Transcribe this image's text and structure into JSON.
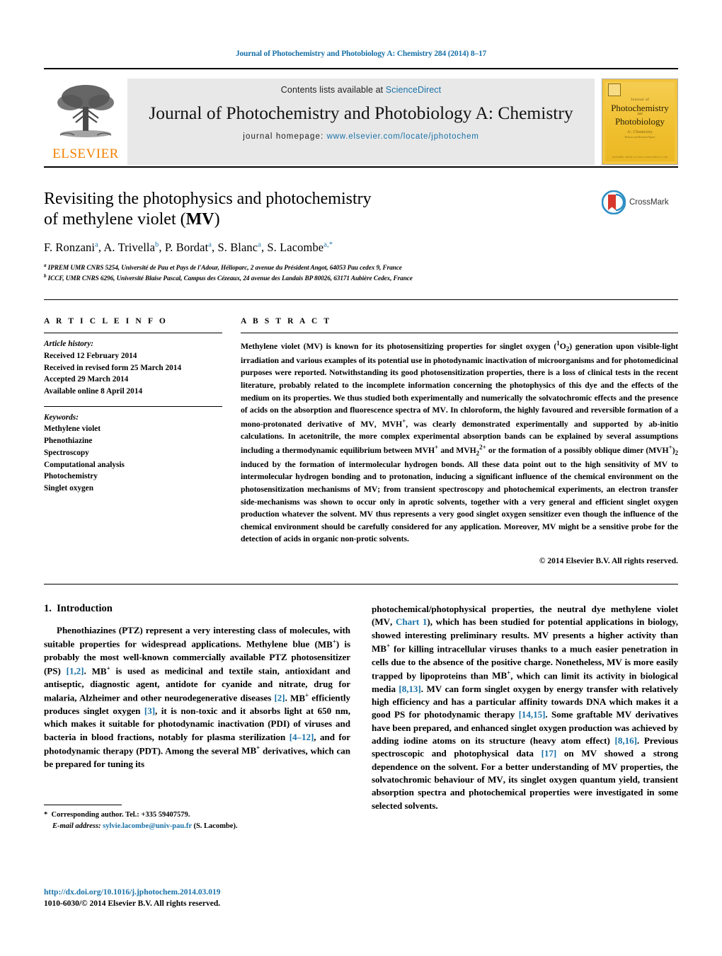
{
  "running_head": "Journal of Photochemistry and Photobiology A: Chemistry 284 (2014) 8–17",
  "masthead": {
    "publisher": "ELSEVIER",
    "contents_prefix": "Contents lists available at ",
    "contents_link": "ScienceDirect",
    "journal_title": "Journal of Photochemistry and Photobiology A: Chemistry",
    "homepage_label": "journal homepage:",
    "homepage_url": "www.elsevier.com/locate/jphotochem",
    "cover": {
      "journal_of": "Journal of",
      "line1": "Photochemistry",
      "and": "and",
      "line2": "Photobiology",
      "subtitle": "A: Chemistry",
      "subtitle2": "Reviews and Research Papers",
      "footer": "available online at www.sciencedirect.com"
    }
  },
  "article": {
    "title_line1": "Revisiting the photophysics and photochemistry",
    "title_line2_pre": "of methylene violet (",
    "title_line2_bold": "MV",
    "title_line2_post": ")",
    "crossmark_label": "CrossMark",
    "authors": [
      {
        "name": "F. Ronzani",
        "sup": "a",
        "sep": ", "
      },
      {
        "name": "A. Trivella",
        "sup": "b",
        "sep": ", "
      },
      {
        "name": "P. Bordat",
        "sup": "a",
        "sep": ", "
      },
      {
        "name": "S. Blanc",
        "sup": "a",
        "sep": ", "
      },
      {
        "name": "S. Lacombe",
        "sup": "a,*",
        "sep": ""
      }
    ],
    "affiliations": [
      {
        "marker": "a",
        "text": "IPREM UMR CNRS 5254, Université de Pau et Pays de l'Adour, Hélioparc, 2 avenue du Président Angot, 64053 Pau cedex 9, France"
      },
      {
        "marker": "b",
        "text": "ICCF, UMR CNRS 6296, Université Blaise Pascal, Campus des Cézeaux, 24 avenue des Landais BP 80026, 63171 Aubière Cedex, France"
      }
    ]
  },
  "article_info": {
    "heading": "A R T I C L E   I N F O",
    "history_label": "Article history:",
    "history": [
      "Received 12 February 2014",
      "Received in revised form 25 March 2014",
      "Accepted 29 March 2014",
      "Available online 8 April 2014"
    ],
    "keywords_label": "Keywords:",
    "keywords": [
      "Methylene violet",
      "Phenothiazine",
      "Spectroscopy",
      "Computational analysis",
      "Photochemistry",
      "Singlet oxygen"
    ]
  },
  "abstract": {
    "heading": "A B S T R A C T",
    "copyright": "© 2014 Elsevier B.V. All rights reserved.",
    "paragraphs": [
      "Methylene violet (MV) is known for its photosensitizing properties for singlet oxygen (1O2) generation upon visible-light irradiation and various examples of its potential use in photodynamic inactivation of microorganisms and for photomedicinal purposes were reported. Notwithstanding its good photosensitization properties, there is a loss of clinical tests in the recent literature, probably related to the incomplete information concerning the photophysics of this dye and the effects of the medium on its properties. We thus studied both experimentally and numerically the solvatochromic effects and the presence of acids on the absorption and fluorescence spectra of MV. In chloroform, the highly favoured and reversible formation of a mono-protonated derivative of MV, MVH+, was clearly demonstrated experimentally and supported by ab-initio calculations. In acetonitrile, the more complex experimental absorption bands can be explained by several assumptions including a thermodynamic equilibrium between MVH+ and MVH2 2+ or the formation of a possibly oblique dimer (MVH+)2 induced by the formation of intermolecular hydrogen bonds. All these data point out to the high sensitivity of MV to intermolecular hydrogen bonding and to protonation, inducing a significant influence of the chemical environment on the photosensitization mechanisms of MV; from transient spectroscopy and photochemical experiments, an electron transfer side-mechanisms was shown to occur only in aprotic solvents, together with a very general and efficient singlet oxygen production whatever the solvent. MV thus represents a very good singlet oxygen sensitizer even though the influence of the chemical environment should be carefully considered for any application. Moreover, MV might be a sensitive probe for the detection of acids in organic non-protic solvents."
    ]
  },
  "introduction": {
    "section_number": "1.",
    "section_title": "Introduction",
    "left_paragraph": "Phenothiazines (PTZ) represent a very interesting class of molecules, with suitable properties for widespread applications. Methylene blue (MB+) is probably the most well-known commercially available PTZ photosensitizer (PS) [1,2]. MB+ is used as medicinal and textile stain, antioxidant and antiseptic, diagnostic agent, antidote for cyanide and nitrate, drug for malaria, Alzheimer and other neurodegenerative diseases [2]. MB+ efficiently produces singlet oxygen [3], it is non-toxic and it absorbs light at 650 nm, which makes it suitable for photodynamic inactivation (PDI) of viruses and bacteria in blood fractions, notably for plasma sterilization [4–12], and for photodynamic therapy (PDT). Among the several MB+ derivatives, which can be prepared for tuning its",
    "right_paragraph": "photochemical/photophysical properties, the neutral dye methylene violet (MV, Chart 1), which has been studied for potential applications in biology, showed interesting preliminary results. MV presents a higher activity than MB+ for killing intracellular viruses thanks to a much easier penetration in cells due to the absence of the positive charge. Nonetheless, MV is more easily trapped by lipoproteins than MB+, which can limit its activity in biological media [8,13]. MV can form singlet oxygen by energy transfer with relatively high efficiency and has a particular affinity towards DNA which makes it a good PS for photodynamic therapy [14,15]. Some graftable MV derivatives have been prepared, and enhanced singlet oxygen production was achieved by adding iodine atoms on its structure (heavy atom effect) [8,16]. Previous spectroscopic and photophysical data [17] on MV showed a strong dependence on the solvent. For a better understanding of MV properties, the solvatochromic behaviour of MV, its singlet oxygen quantum yield, transient absorption spectra and photochemical properties were investigated in some selected solvents."
  },
  "footnote": {
    "star": "*",
    "corresponding": "Corresponding author. Tel.: +335 59407579.",
    "email_label": "E-mail address:",
    "email": "sylvie.lacombe@univ-pau.fr",
    "email_suffix": "(S. Lacombe)."
  },
  "doi_block": {
    "doi_url": "http://dx.doi.org/10.1016/j.jphotochem.2014.03.019",
    "issn_line": "1010-6030/© 2014 Elsevier B.V. All rights reserved."
  },
  "colors": {
    "link": "#1a72a8",
    "elsevier_orange": "#f08000",
    "cover_yellow": "#f2c43c"
  }
}
